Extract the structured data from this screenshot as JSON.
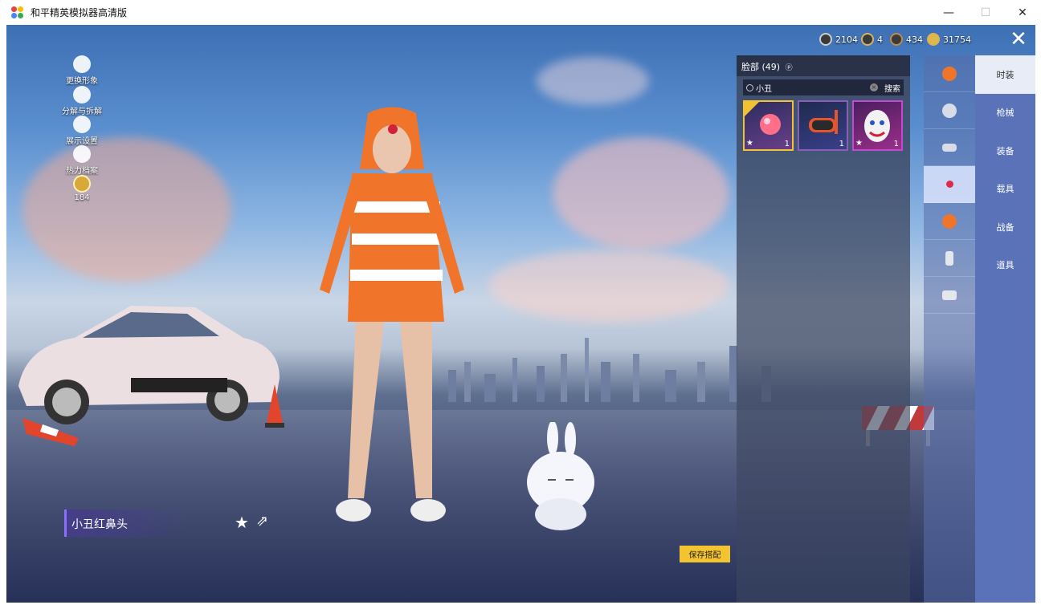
{
  "window": {
    "title": "和平精英模拟器高清版"
  },
  "window_controls": {
    "minimize": "—",
    "maximize": "☐",
    "close": "✕"
  },
  "left_menu": [
    {
      "label": "更换形象",
      "icon": "person-icon"
    },
    {
      "label": "分解与拆解",
      "icon": "gear-icon"
    },
    {
      "label": "展示设置",
      "icon": "eye-icon"
    },
    {
      "label": "热力档案",
      "icon": "flame-icon"
    },
    {
      "label": "184",
      "icon": "level-badge-icon"
    }
  ],
  "currency": [
    {
      "value": "2104",
      "icon": "silver-coin-icon"
    },
    {
      "value": "4",
      "icon": "badge-coin-icon"
    },
    {
      "value": "434",
      "icon": "bronze-coin-icon"
    },
    {
      "value": "31754",
      "icon": "gold-coin-icon"
    }
  ],
  "panel": {
    "heading": "脸部 (49)",
    "search_value": "小丑",
    "search_button": "搜索",
    "items": [
      {
        "name": "red-nose",
        "count": "1",
        "selected": true
      },
      {
        "name": "snorkel-mask",
        "count": "1",
        "selected": false
      },
      {
        "name": "clown-mask",
        "count": "1",
        "selected": false
      }
    ]
  },
  "tabs": [
    "时装",
    "枪械",
    "装备",
    "载具",
    "战备",
    "道具"
  ],
  "active_tab": "时装",
  "outfit_name": "小丑红鼻头",
  "save_button": "保存搭配",
  "colors": {
    "accent": "#f4c430",
    "tab_bg": "#5a73b8",
    "selected_border": "#f1c232"
  }
}
